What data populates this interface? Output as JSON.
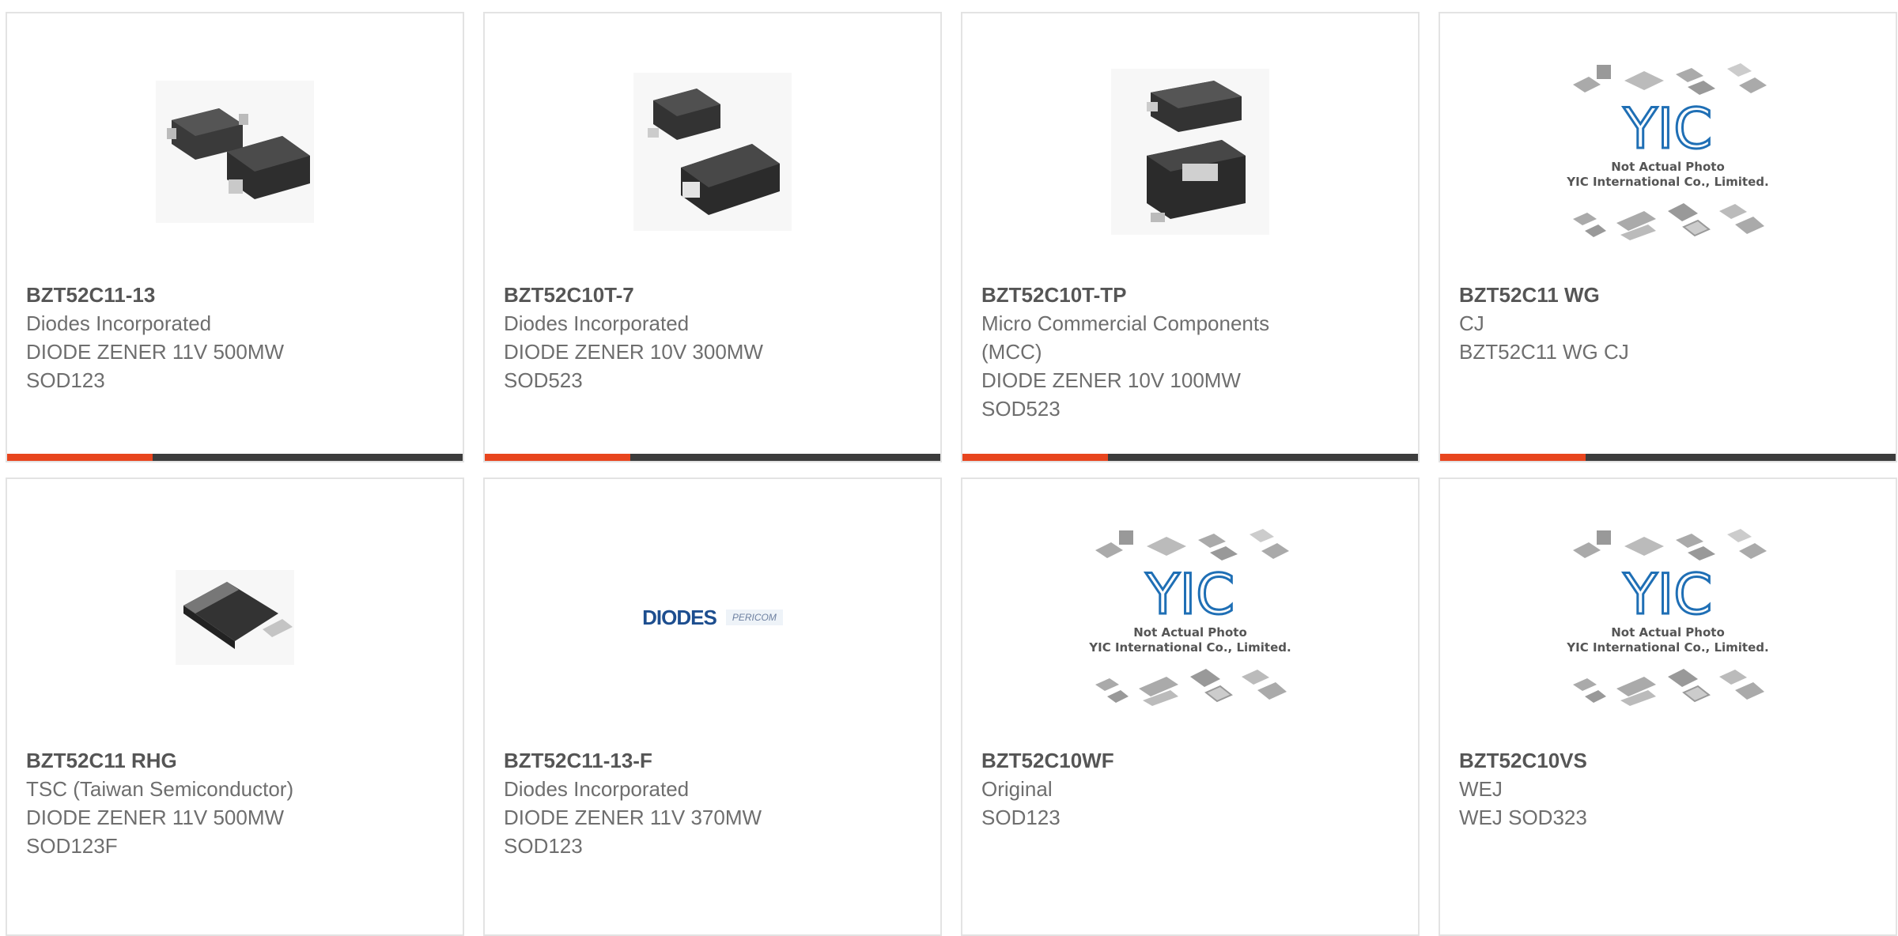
{
  "products": [
    {
      "part": "BZT52C11-13",
      "lines": [
        "Diodes Incorporated",
        "DIODE ZENER 11V 500MW",
        "SOD123"
      ],
      "image": "sod123-pair-photo"
    },
    {
      "part": "BZT52C10T-7",
      "lines": [
        "Diodes Incorporated",
        "DIODE ZENER 10V 300MW",
        "SOD523"
      ],
      "image": "sod523-pair-photo"
    },
    {
      "part": "BZT52C10T-TP",
      "lines": [
        "Micro Commercial Components",
        "(MCC)",
        "DIODE ZENER 10V 100MW",
        "SOD523"
      ],
      "image": "sod523-stack-photo"
    },
    {
      "part": "BZT52C11 WG",
      "lines": [
        "CJ",
        "BZT52C11 WG CJ"
      ],
      "image": "yic-placeholder"
    },
    {
      "part": "BZT52C11 RHG",
      "lines": [
        "TSC (Taiwan Semiconductor)",
        "DIODE ZENER 11V 500MW",
        "SOD123F"
      ],
      "image": "sod123f-photo"
    },
    {
      "part": "BZT52C11-13-F",
      "lines": [
        "Diodes Incorporated",
        "DIODE ZENER 11V 370MW",
        "SOD123"
      ],
      "image": "diodes-pericom-logo"
    },
    {
      "part": "BZT52C10WF",
      "lines": [
        "Original",
        "SOD123"
      ],
      "image": "yic-placeholder"
    },
    {
      "part": "BZT52C10VS",
      "lines": [
        "WEJ",
        "WEJ SOD323"
      ],
      "image": "yic-placeholder"
    }
  ],
  "placeholder": {
    "line1": "Not Actual Photo",
    "line2": "YIC International Co., Limited.",
    "logo": "YIC"
  },
  "diodes_logo": {
    "brand": "DIODES",
    "partner": "PERICOM"
  },
  "colors": {
    "accent": "#e8451e",
    "bar": "#3c3c3c",
    "text": "#6e6e6e",
    "part": "#555555"
  }
}
